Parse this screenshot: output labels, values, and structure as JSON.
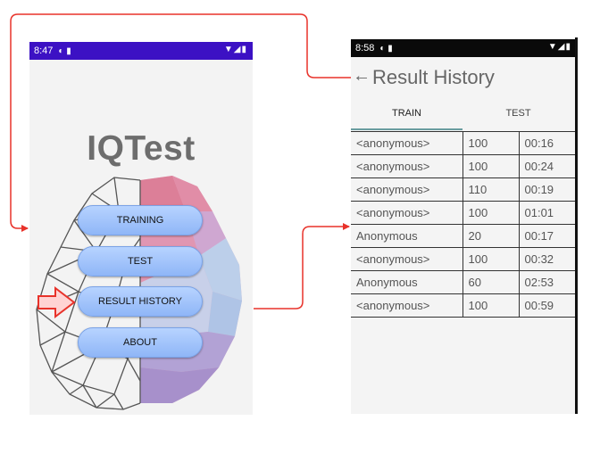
{
  "home": {
    "status": {
      "time": "8:47"
    },
    "app_title": "IQTest",
    "menu": [
      {
        "label": "TRAINING"
      },
      {
        "label": "TEST"
      },
      {
        "label": "RESULT HISTORY"
      },
      {
        "label": "ABOUT"
      }
    ]
  },
  "history": {
    "status": {
      "time": "8:58"
    },
    "title": "Result History",
    "tabs": [
      {
        "label": "TRAIN",
        "selected": true
      },
      {
        "label": "TEST",
        "selected": false
      }
    ],
    "rows": [
      [
        "<anonymous>",
        "100",
        "00:16"
      ],
      [
        "<anonymous>",
        "100",
        "00:24"
      ],
      [
        "<anonymous>",
        "110",
        "00:19"
      ],
      [
        "<anonymous>",
        "100",
        "01:01"
      ],
      [
        "Anonymous",
        "20",
        "00:17"
      ],
      [
        "<anonymous>",
        "100",
        "00:32"
      ],
      [
        "Anonymous",
        "60",
        "02:53"
      ],
      [
        "<anonymous>",
        "100",
        "00:59"
      ]
    ]
  },
  "colors": {
    "status_bar_home": "#3c11c4",
    "status_bar_history": "#0a0a0a",
    "connector_red": "#e8322a",
    "button_blue": "#a9c8fb",
    "tab_indicator": "#6a9da0"
  },
  "icons": [
    "status-icons",
    "back-arrow-icon",
    "pointer-arrow-icon",
    "brain-illustration"
  ]
}
